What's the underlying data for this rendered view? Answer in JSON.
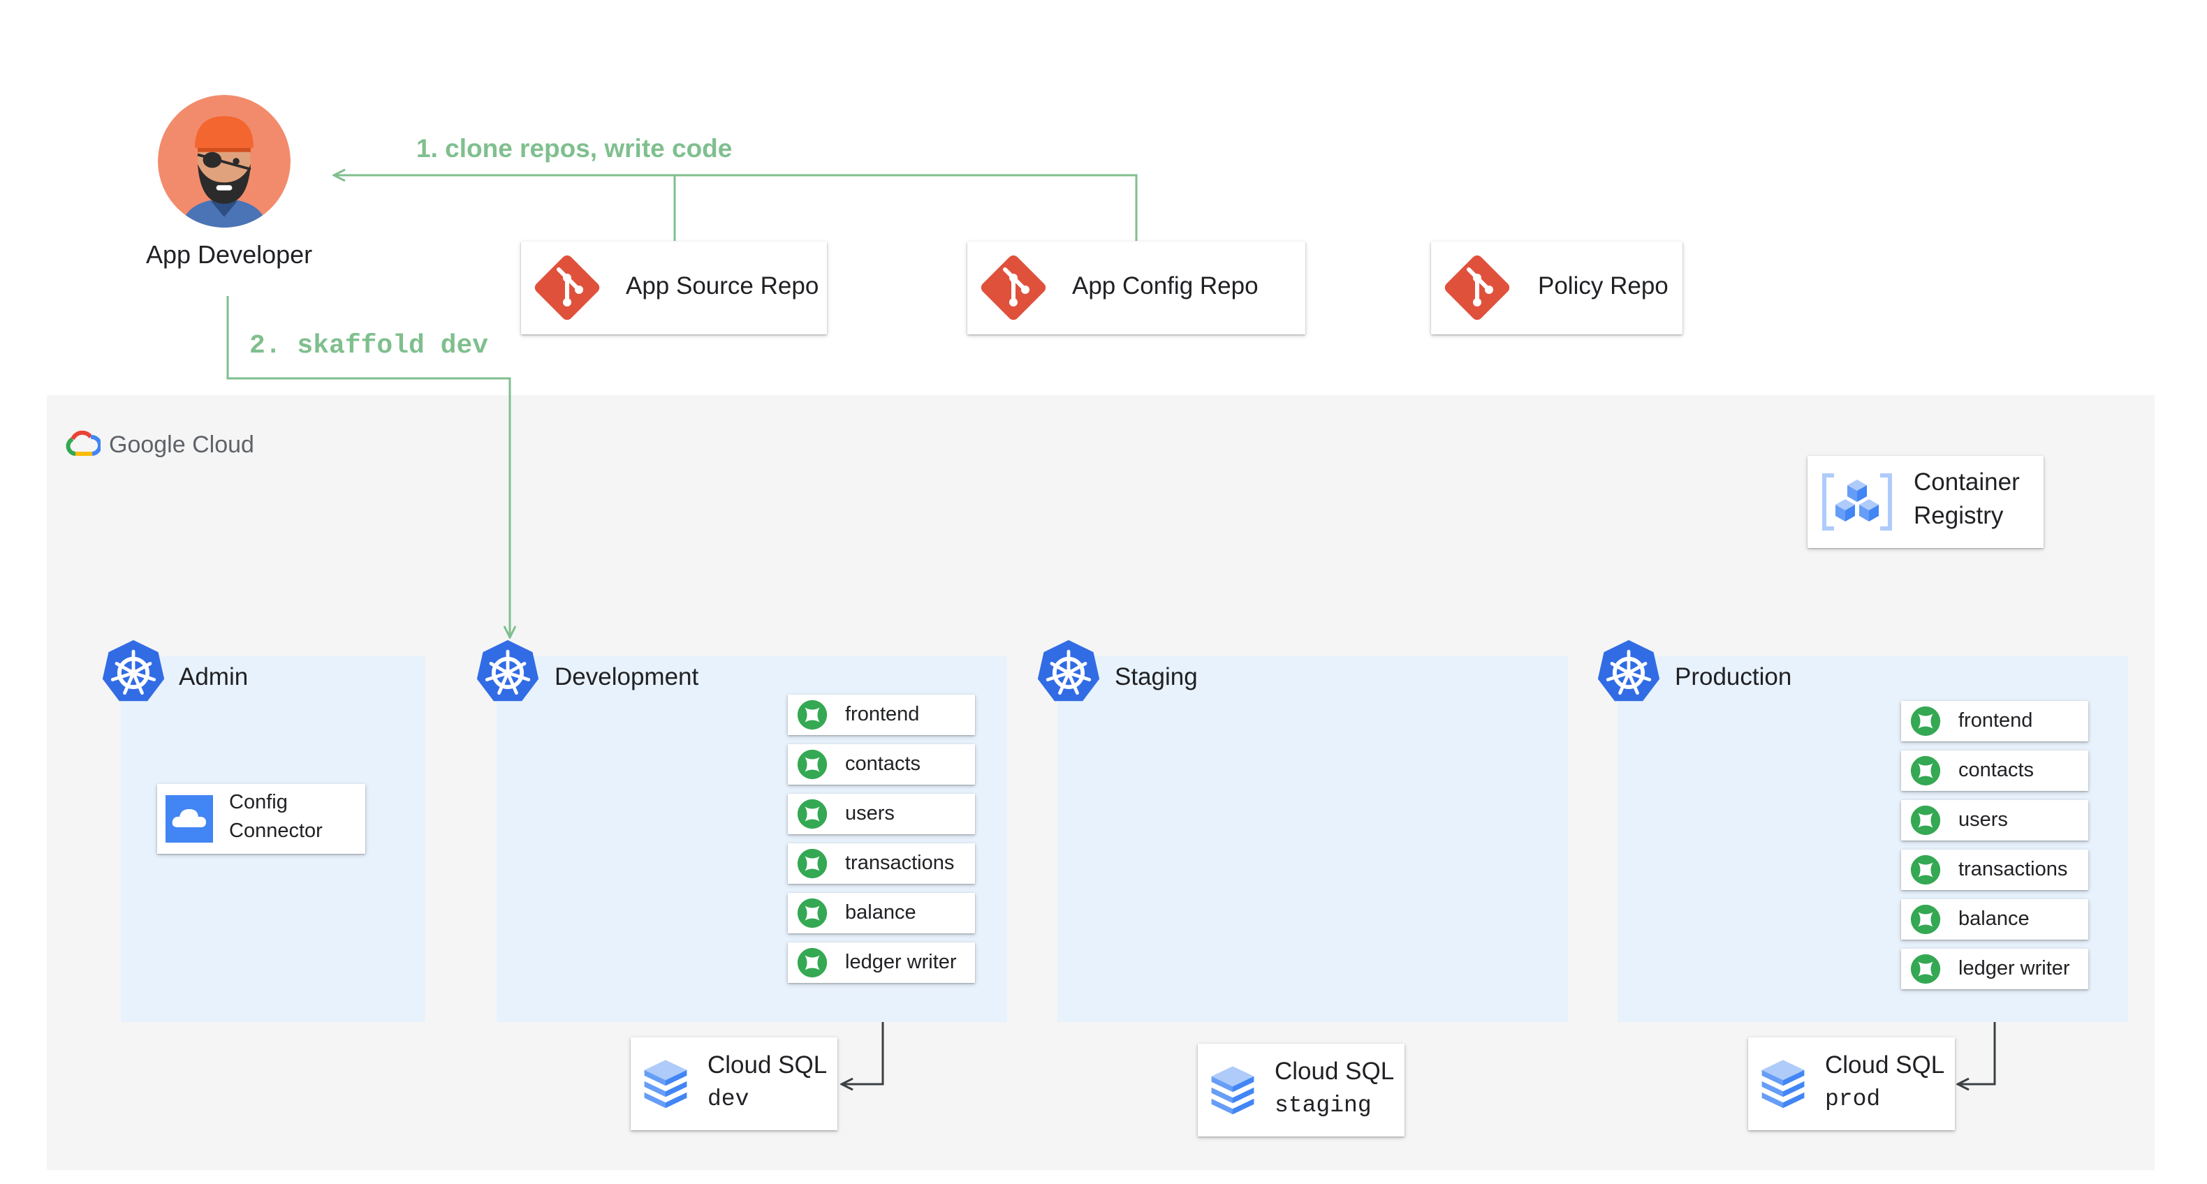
{
  "developer": {
    "label": "App Developer"
  },
  "flows": {
    "clone": "1. clone repos, write code",
    "skaffold": "2. skaffold dev"
  },
  "repos": [
    {
      "label": "App Source Repo",
      "icon": "git-icon"
    },
    {
      "label": "App Config Repo",
      "icon": "git-icon"
    },
    {
      "label": "Policy Repo",
      "icon": "git-icon"
    }
  ],
  "cloud": {
    "label": "Google Cloud"
  },
  "registry": {
    "line1": "Container",
    "line2": "Registry"
  },
  "clusters": {
    "admin": {
      "label": "Admin",
      "connector_line1": "Config",
      "connector_line2": "Connector"
    },
    "development": {
      "label": "Development",
      "services": [
        "frontend",
        "contacts",
        "users",
        "transactions",
        "balance",
        "ledger writer"
      ]
    },
    "staging": {
      "label": "Staging"
    },
    "production": {
      "label": "Production",
      "services": [
        "frontend",
        "contacts",
        "users",
        "transactions",
        "balance",
        "ledger writer"
      ]
    }
  },
  "databases": {
    "dev": {
      "line1": "Cloud SQL",
      "line2": "dev"
    },
    "staging": {
      "line1": "Cloud SQL",
      "line2": "staging"
    },
    "prod": {
      "line1": "Cloud SQL",
      "line2": "prod"
    }
  },
  "colors": {
    "arrow": "#7fbf8e",
    "git": "#e0513c",
    "kubernetes": "#326ce5",
    "service": "#34a853",
    "cluster_bg": "#e8f2fc",
    "panel_bg": "#f5f5f5"
  }
}
